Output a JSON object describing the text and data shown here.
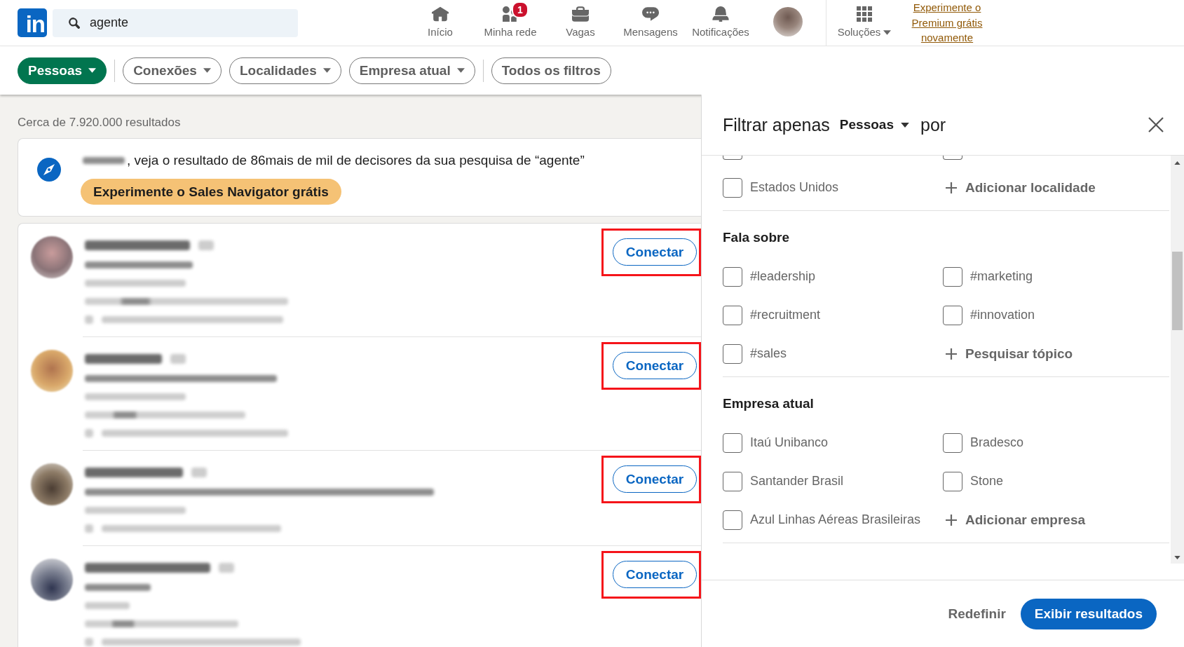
{
  "header": {
    "logo": "in",
    "search": {
      "value": "agente"
    },
    "nav_items": [
      {
        "label": "Início"
      },
      {
        "label": "Minha rede",
        "badge": "1"
      },
      {
        "label": "Vagas"
      },
      {
        "label": "Mensagens"
      },
      {
        "label": "Notificações"
      }
    ],
    "solutions": "Soluções",
    "premium_link": "Experimente o Premium grátis novamente"
  },
  "filter_bar": [
    {
      "kind": "type",
      "label": "Pessoas",
      "selected": true
    },
    {
      "kind": "filter",
      "label": "Conexões",
      "selected": false
    },
    {
      "kind": "filter",
      "label": "Localidades",
      "selected": false
    },
    {
      "kind": "filter",
      "label": "Empresa atual",
      "selected": false
    },
    {
      "kind": "all_filters",
      "label": "Todos os filtros",
      "selected": false
    }
  ],
  "results_count": "Cerca de 7.920.000 resultados",
  "promo": {
    "message": ", veja o resultado de 86mais de mil de decisores da sua pesquisa de “agente”",
    "button": "Experimente o Sales Navigator grátis"
  },
  "results": [
    {
      "action": "Conectar",
      "highlighted": true
    },
    {
      "action": "Conectar",
      "highlighted": true
    },
    {
      "action": "Conectar",
      "highlighted": true
    },
    {
      "action": "Conectar",
      "highlighted": true
    }
  ],
  "filter_panel": {
    "title": "Filtrar apenas",
    "type_select": "Pessoas",
    "title_suffix": "por",
    "sections": [
      {
        "options": [
          {
            "kind": "checkbox",
            "checked": false
          },
          {
            "kind": "checkbox",
            "checked": false
          },
          {
            "kind": "checkbox",
            "label": "Estados Unidos",
            "checked": false
          },
          {
            "kind": "add",
            "label": "Adicionar localidade"
          }
        ]
      },
      {
        "heading": "Fala sobre",
        "options": [
          {
            "kind": "checkbox",
            "label": "#leadership",
            "checked": false
          },
          {
            "kind": "checkbox",
            "label": "#marketing",
            "checked": false
          },
          {
            "kind": "checkbox",
            "label": "#recruitment",
            "checked": false
          },
          {
            "kind": "checkbox",
            "label": "#innovation",
            "checked": false
          },
          {
            "kind": "checkbox",
            "label": "#sales",
            "checked": false
          },
          {
            "kind": "add",
            "label": "Pesquisar tópico"
          }
        ]
      },
      {
        "heading": "Empresa atual",
        "options": [
          {
            "kind": "checkbox",
            "label": "Itaú Unibanco",
            "checked": false
          },
          {
            "kind": "checkbox",
            "label": "Bradesco",
            "checked": false
          },
          {
            "kind": "checkbox",
            "label": "Santander Brasil",
            "checked": false
          },
          {
            "kind": "checkbox",
            "label": "Stone",
            "checked": false
          },
          {
            "kind": "checkbox",
            "label": "Azul Linhas Aéreas Brasileiras",
            "checked": false
          },
          {
            "kind": "add",
            "label": "Adicionar empresa"
          }
        ]
      }
    ],
    "reset": "Redefinir",
    "apply": "Exibir resultados"
  }
}
